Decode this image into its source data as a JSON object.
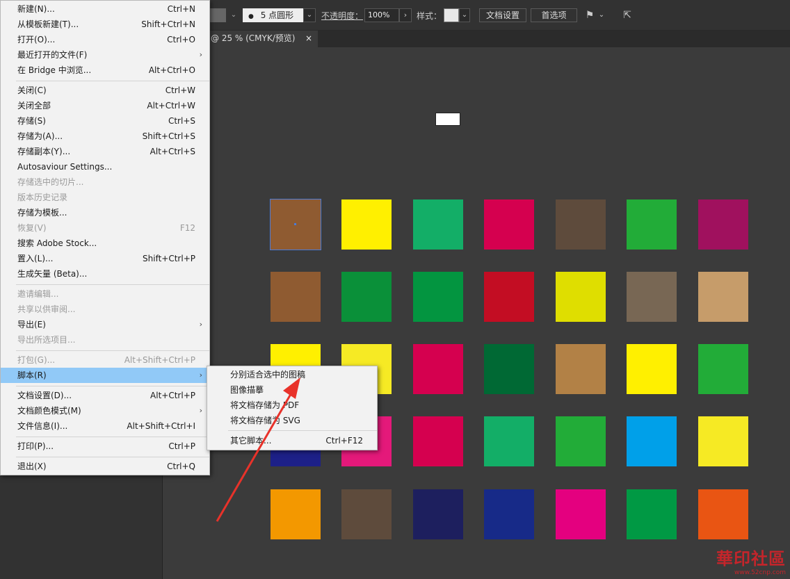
{
  "control_bar": {
    "brush_label": "5 点圆形",
    "opacity_label": "不透明度：",
    "opacity_value": "100%",
    "style_label": "样式：",
    "doc_settings_button": "文档设置",
    "preferences_button": "首选项"
  },
  "document_tab": {
    "title": "@ 25 % (CMYK/预览)",
    "close": "×"
  },
  "file_menu": {
    "items": [
      {
        "label": "新建(N)...",
        "shortcut": "Ctrl+N"
      },
      {
        "label": "从模板新建(T)...",
        "shortcut": "Shift+Ctrl+N"
      },
      {
        "label": "打开(O)...",
        "shortcut": "Ctrl+O"
      },
      {
        "label": "最近打开的文件(F)",
        "shortcut": ""
      },
      {
        "label": "在 Bridge 中浏览...",
        "shortcut": "Alt+Ctrl+O"
      },
      {
        "label": "关闭(C)",
        "shortcut": "Ctrl+W"
      },
      {
        "label": "关闭全部",
        "shortcut": "Alt+Ctrl+W"
      },
      {
        "label": "存储(S)",
        "shortcut": "Ctrl+S"
      },
      {
        "label": "存储为(A)...",
        "shortcut": "Shift+Ctrl+S"
      },
      {
        "label": "存储副本(Y)...",
        "shortcut": "Alt+Ctrl+S"
      },
      {
        "label": "Autosaviour Settings...",
        "shortcut": ""
      },
      {
        "label": "存储选中的切片...",
        "shortcut": ""
      },
      {
        "label": "版本历史记录",
        "shortcut": ""
      },
      {
        "label": "存储为模板...",
        "shortcut": ""
      },
      {
        "label": "恢复(V)",
        "shortcut": "F12"
      },
      {
        "label": "搜索 Adobe Stock...",
        "shortcut": ""
      },
      {
        "label": "置入(L)...",
        "shortcut": "Shift+Ctrl+P"
      },
      {
        "label": "生成矢量 (Beta)...",
        "shortcut": ""
      },
      {
        "label": "邀请编辑...",
        "shortcut": ""
      },
      {
        "label": "共享以供审阅...",
        "shortcut": ""
      },
      {
        "label": "导出(E)",
        "shortcut": ""
      },
      {
        "label": "导出所选项目...",
        "shortcut": ""
      },
      {
        "label": "打包(G)...",
        "shortcut": "Alt+Shift+Ctrl+P"
      },
      {
        "label": "脚本(R)",
        "shortcut": ""
      },
      {
        "label": "文档设置(D)...",
        "shortcut": "Alt+Ctrl+P"
      },
      {
        "label": "文档颜色模式(M)",
        "shortcut": ""
      },
      {
        "label": "文件信息(I)...",
        "shortcut": "Alt+Shift+Ctrl+I"
      },
      {
        "label": "打印(P)...",
        "shortcut": "Ctrl+P"
      },
      {
        "label": "退出(X)",
        "shortcut": "Ctrl+Q"
      }
    ],
    "submenu_arrow": "›"
  },
  "scripts_submenu": {
    "items": [
      {
        "label": "分别适合选中的图稿",
        "shortcut": ""
      },
      {
        "label": "图像描摹",
        "shortcut": ""
      },
      {
        "label": "将文档存储为 PDF",
        "shortcut": ""
      },
      {
        "label": "将文档存储为 SVG",
        "shortcut": ""
      },
      {
        "label": "其它脚本...",
        "shortcut": "Ctrl+F12"
      }
    ]
  },
  "swatch_colors": [
    [
      "#8f5b31",
      "#fff000",
      "#13ae67",
      "#d5004f",
      "#5e4b3c",
      "#22ac38",
      "#a0115e"
    ],
    [
      "#8f5b31",
      "#0a9039",
      "#039540",
      "#c30d23",
      "#dfde00",
      "#786754",
      "#c69c6a"
    ],
    [
      "#fff000",
      "#f6ea24",
      "#d5004f",
      "#006934",
      "#b28146",
      "#fff000",
      "#22ac38"
    ],
    [
      "#1d2088",
      "#e4197a",
      "#d5004f",
      "#13ae67",
      "#22ac38",
      "#00a0e9",
      "#f6ea24"
    ],
    [
      "#f39800",
      "#5e4b3c",
      "#1d1f5e",
      "#172a88",
      "#e4007f",
      "#009944",
      "#e95513"
    ]
  ],
  "watermark": {
    "logo": "華印社區",
    "url": "www.52cnp.com"
  },
  "colors": {
    "menu_highlight": "#91c9f7",
    "annotation_arrow": "#e8322a"
  }
}
